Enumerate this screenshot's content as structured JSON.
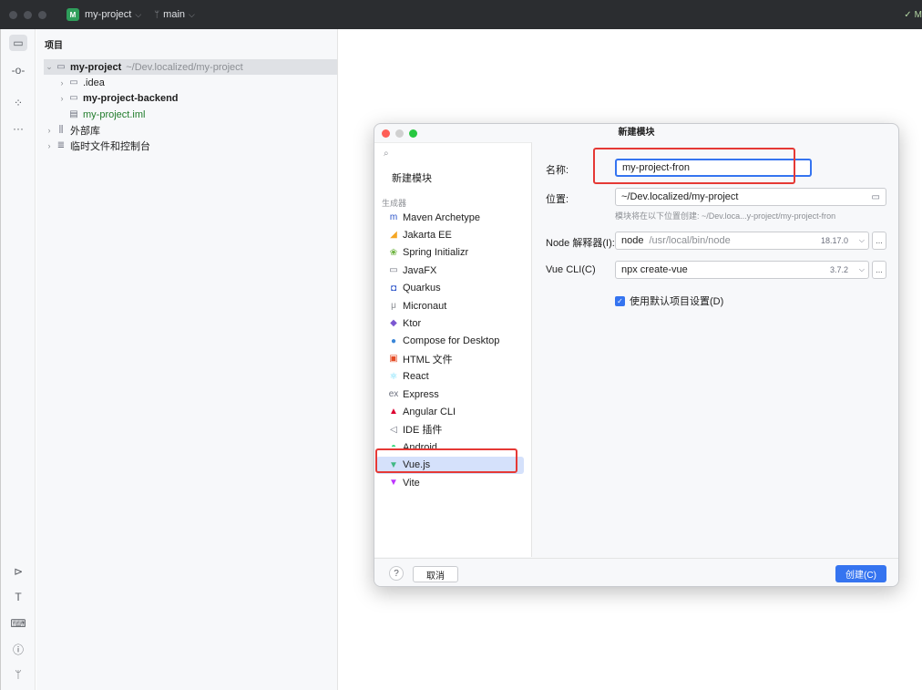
{
  "titlebar": {
    "project_badge": "M",
    "project_name": "my-project",
    "branch_name": "main",
    "right_text": "M"
  },
  "project_panel": {
    "title": "项目",
    "tree": [
      {
        "label": "my-project",
        "path": "~/Dev.localized/my-project",
        "icon": "module-folder-icon"
      },
      {
        "label": ".idea",
        "icon": "folder-icon"
      },
      {
        "label": "my-project-backend",
        "icon": "module-folder-icon"
      },
      {
        "label": "my-project.iml",
        "icon": "file-icon"
      },
      {
        "label": "外部库",
        "icon": "library-icon"
      },
      {
        "label": "临时文件和控制台",
        "icon": "scratch-icon"
      }
    ]
  },
  "dialog": {
    "title": "新建模块",
    "search_placeholder": "",
    "new_module_item": "新建模块",
    "generators_label": "生成器",
    "generators": [
      {
        "label": "Maven Archetype",
        "icon": "maven-icon",
        "color": "#2750c8"
      },
      {
        "label": "Jakarta EE",
        "icon": "jakarta-icon",
        "color": "#f5a623"
      },
      {
        "label": "Spring Initializr",
        "icon": "spring-icon",
        "color": "#6db33f"
      },
      {
        "label": "JavaFX",
        "icon": "javafx-icon",
        "color": "#6c707e"
      },
      {
        "label": "Quarkus",
        "icon": "quarkus-icon",
        "color": "#2750c8"
      },
      {
        "label": "Micronaut",
        "icon": "micronaut-icon",
        "color": "#8c8f94"
      },
      {
        "label": "Ktor",
        "icon": "ktor-icon",
        "color": "#7b57d1"
      },
      {
        "label": "Compose for Desktop",
        "icon": "compose-icon",
        "color": "#3a86d8"
      },
      {
        "label": "HTML 文件",
        "icon": "html-icon",
        "color": "#e44d26"
      },
      {
        "label": "React",
        "icon": "react-icon",
        "color": "#61dafb"
      },
      {
        "label": "Express",
        "icon": "express-icon",
        "color": "#6c707e"
      },
      {
        "label": "Angular CLI",
        "icon": "angular-icon",
        "color": "#dd0031"
      },
      {
        "label": "IDE 插件",
        "icon": "plugin-icon",
        "color": "#6c707e"
      },
      {
        "label": "Android",
        "icon": "android-icon",
        "color": "#3ddc84"
      },
      {
        "label": "Vue.js",
        "icon": "vue-icon",
        "color": "#41b883"
      },
      {
        "label": "Vite",
        "icon": "vite-icon",
        "color": "#bd34fe"
      }
    ],
    "selected_generator": "Vue.js",
    "form": {
      "name_label": "名称:",
      "name_value": "my-project-fron",
      "location_label": "位置:",
      "location_value": "~/Dev.localized/my-project",
      "location_hint": "模块将在以下位置创建: ~/Dev.loca...y-project/my-project-fron",
      "node_label": "Node 解释器(I):",
      "node_name": "node",
      "node_path": "/usr/local/bin/node",
      "node_version": "18.17.0",
      "vuecli_label": "Vue CLI(C)",
      "vuecli_value": "npx create-vue",
      "vuecli_version": "3.7.2",
      "more_label": "...",
      "checkbox_label": "使用默认项目设置(D)",
      "checkbox_checked": true
    },
    "footer": {
      "help_label": "?",
      "cancel_label": "取消",
      "create_label": "创建(C)"
    }
  },
  "colors": {
    "accent": "#3574f0",
    "highlight_box": "#e53935",
    "titlebar_bg": "#2b2d30"
  }
}
